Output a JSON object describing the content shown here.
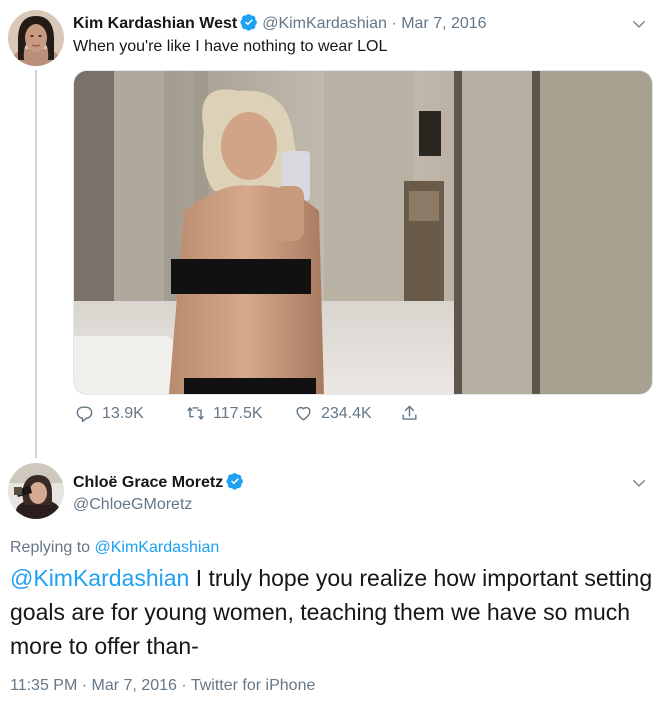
{
  "tweet1": {
    "display_name": "Kim Kardashian West",
    "handle": "@KimKardashian",
    "separator": "·",
    "date": "Mar 7, 2016",
    "text": "When you're like I have nothing to wear LOL",
    "stats": {
      "replies": "13.9K",
      "retweets": "117.5K",
      "likes": "234.4K"
    }
  },
  "tweet2": {
    "display_name": "Chloë Grace Moretz",
    "handle": "@ChloeGMoretz",
    "replying_prefix": "Replying to",
    "replying_to": "@KimKardashian",
    "mention": "@KimKardashian",
    "text": " I truly hope you realize how important setting goals are for young women, teaching them we have so much more to offer than-",
    "time": "11:35 PM",
    "separator1": "·",
    "date": "Mar 7, 2016",
    "separator2": "·",
    "source": "Twitter for iPhone"
  },
  "colors": {
    "accent": "#1da1f2",
    "secondary_text": "#657786",
    "primary_text": "#14171a",
    "thread_line": "#ccd6dd"
  }
}
